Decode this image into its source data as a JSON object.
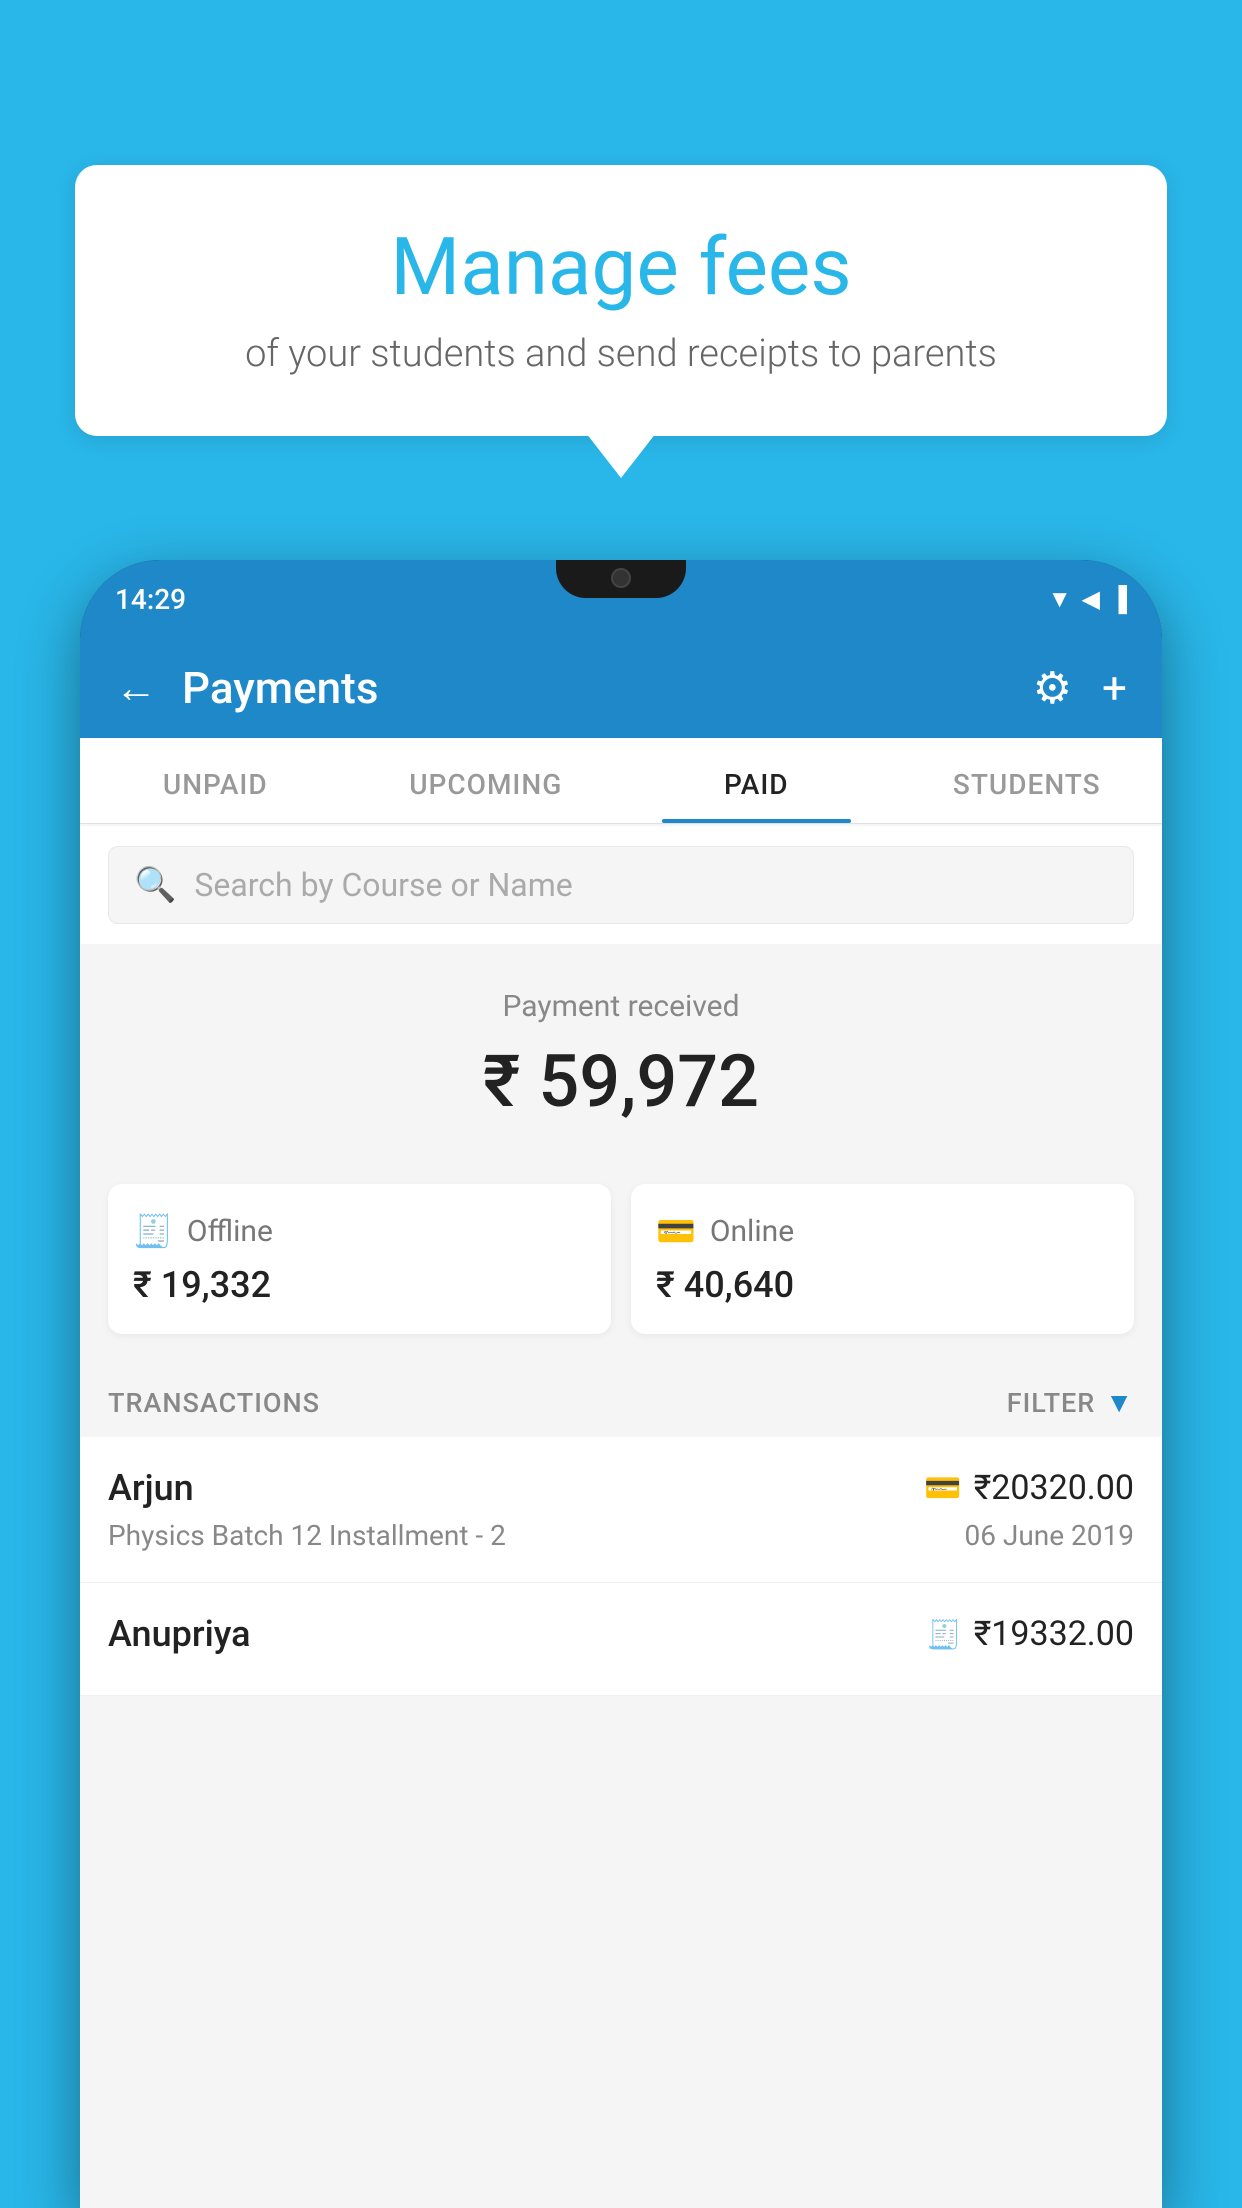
{
  "background_color": "#29b6e8",
  "bubble": {
    "title": "Manage fees",
    "subtitle": "of your students and send receipts to parents"
  },
  "status_bar": {
    "time": "14:29",
    "icons": "▲ ◀ ▐"
  },
  "header": {
    "title": "Payments",
    "back_label": "←",
    "gear_label": "⚙",
    "plus_label": "+"
  },
  "tabs": [
    {
      "label": "UNPAID",
      "active": false
    },
    {
      "label": "UPCOMING",
      "active": false
    },
    {
      "label": "PAID",
      "active": true
    },
    {
      "label": "STUDENTS",
      "active": false
    }
  ],
  "search": {
    "placeholder": "Search by Course or Name"
  },
  "payment_received": {
    "label": "Payment received",
    "amount": "₹ 59,972"
  },
  "payment_cards": [
    {
      "icon": "offline",
      "type": "Offline",
      "amount": "₹ 19,332"
    },
    {
      "icon": "online",
      "type": "Online",
      "amount": "₹ 40,640"
    }
  ],
  "transactions_label": "TRANSACTIONS",
  "filter_label": "FILTER",
  "transactions": [
    {
      "name": "Arjun",
      "payment_type": "card",
      "amount": "₹20320.00",
      "course": "Physics Batch 12 Installment - 2",
      "date": "06 June 2019"
    },
    {
      "name": "Anupriya",
      "payment_type": "cash",
      "amount": "₹19332.00",
      "course": "",
      "date": ""
    }
  ]
}
